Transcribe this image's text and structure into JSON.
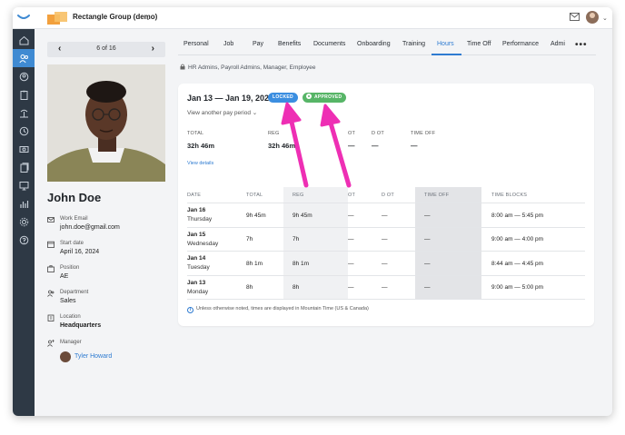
{
  "header": {
    "company_name": "Rectangle Group (demo)"
  },
  "profile_nav": {
    "counter": "6 of 16"
  },
  "profile": {
    "name": "John Doe",
    "fields": [
      {
        "label": "Work Email",
        "value": "john.doe@gmail.com",
        "icon": "mail-icon"
      },
      {
        "label": "Start date",
        "value": "April 16, 2024",
        "icon": "calendar-icon"
      },
      {
        "label": "Position",
        "value": "AE",
        "icon": "briefcase-icon"
      },
      {
        "label": "Department",
        "value": "Sales",
        "icon": "people-icon"
      },
      {
        "label": "Location",
        "value": "Headquarters",
        "icon": "building-icon"
      }
    ],
    "manager_label": "Manager",
    "manager_name": "Tyler Howard"
  },
  "tabs": [
    "Personal",
    "Job",
    "Pay",
    "Benefits",
    "Documents",
    "Onboarding",
    "Training",
    "Hours",
    "Time Off",
    "Performance",
    "Admi"
  ],
  "active_tab": "Hours",
  "permissions": "HR Admins, Payroll Admins, Manager, Employee",
  "pay_period": {
    "title": "Jan 13 — Jan 19, 2025",
    "locked_badge": "LOCKED",
    "approved_badge": "APPROVED",
    "other_link": "View another pay period"
  },
  "summary": {
    "labels": [
      "TOTAL",
      "REG",
      "OT",
      "D OT",
      "TIME OFF"
    ],
    "values": [
      "32h 46m",
      "32h 46m",
      "—",
      "—",
      "—"
    ],
    "view_details": "View details"
  },
  "table": {
    "headers": [
      "DATE",
      "TOTAL",
      "REG",
      "OT",
      "D OT",
      "TIME OFF",
      "TIME BLOCKS"
    ],
    "rows": [
      {
        "date": "Jan 16",
        "day": "Thursday",
        "total": "9h 45m",
        "reg": "9h 45m",
        "ot": "—",
        "dot": "—",
        "timeoff": "—",
        "blocks": "8:00 am — 5:45 pm"
      },
      {
        "date": "Jan 15",
        "day": "Wednesday",
        "total": "7h",
        "reg": "7h",
        "ot": "—",
        "dot": "—",
        "timeoff": "—",
        "blocks": "9:00 am — 4:00 pm"
      },
      {
        "date": "Jan 14",
        "day": "Tuesday",
        "total": "8h 1m",
        "reg": "8h 1m",
        "ot": "—",
        "dot": "—",
        "timeoff": "—",
        "blocks": "8:44 am — 4:45 pm"
      },
      {
        "date": "Jan 13",
        "day": "Monday",
        "total": "8h",
        "reg": "8h",
        "ot": "—",
        "dot": "—",
        "timeoff": "—",
        "blocks": "9:00 am — 5:00 pm"
      }
    ]
  },
  "footnote": "Unless otherwise noted, times are displayed in Mountain Time (US & Canada)",
  "colors": {
    "accent": "#2e7bd1",
    "locked": "#3b8ee0",
    "approved": "#57b567",
    "sidebar": "#2e3945",
    "annotation_arrow": "#ee2fb4"
  },
  "sidebar_icons": [
    "home-icon",
    "people-icon",
    "search-user-icon",
    "clipboard-icon",
    "palm-tree-icon",
    "clock-icon",
    "money-icon",
    "document-stack-icon",
    "monitor-icon",
    "bar-chart-icon",
    "gear-icon",
    "help-icon"
  ]
}
